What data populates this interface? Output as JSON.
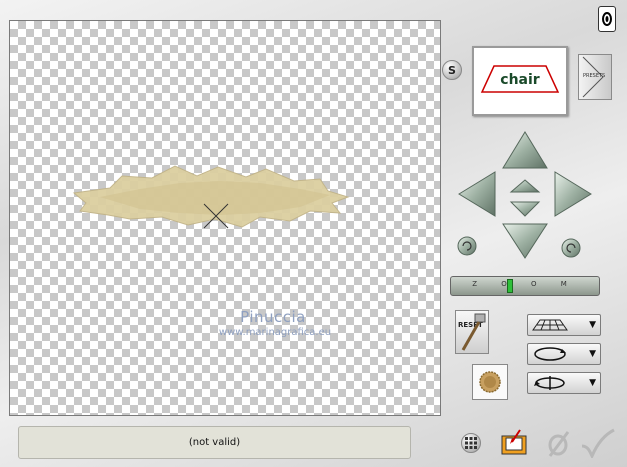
{
  "canvas": {
    "watermark_title": "Pinuccia",
    "watermark_url": "www.marinagrafica.eu"
  },
  "status": {
    "text": "(not valid)"
  },
  "controls": {
    "s_button": "S",
    "presets_label": "PRESETS",
    "preview_text": "chair",
    "zoom_label": "Z O O M",
    "reset_label": "RESET"
  },
  "colors": {
    "shape_fill": "#dccfa0",
    "accent": "#8fa0c0"
  }
}
